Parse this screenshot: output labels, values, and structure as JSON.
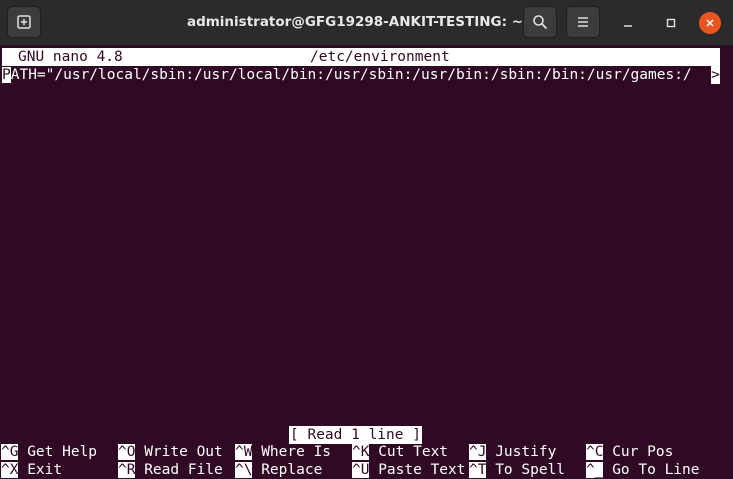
{
  "window": {
    "title": "administrator@GFG19298-ANKIT-TESTING: ~"
  },
  "nano": {
    "version": "GNU nano 4.8",
    "filename": "/etc/environment",
    "line_first_char": "P",
    "line_rest": "ATH=\"/usr/local/sbin:/usr/local/bin:/usr/sbin:/usr/bin:/sbin:/bin:/usr/games:/",
    "overflow_indicator": ">",
    "status": "[ Read 1 line ]"
  },
  "shortcuts": {
    "row1": [
      {
        "key": "^G",
        "label": "Get Help"
      },
      {
        "key": "^O",
        "label": "Write Out"
      },
      {
        "key": "^W",
        "label": "Where Is"
      },
      {
        "key": "^K",
        "label": "Cut Text"
      },
      {
        "key": "^J",
        "label": "Justify"
      },
      {
        "key": "^C",
        "label": "Cur Pos"
      }
    ],
    "row2": [
      {
        "key": "^X",
        "label": "Exit"
      },
      {
        "key": "^R",
        "label": "Read File"
      },
      {
        "key": "^\\",
        "label": "Replace"
      },
      {
        "key": "^U",
        "label": "Paste Text"
      },
      {
        "key": "^T",
        "label": "To Spell"
      },
      {
        "key": "^_",
        "label": "Go To Line"
      }
    ]
  },
  "colors": {
    "terminal_bg": "#300a24",
    "titlebar_bg": "#2b2b2b",
    "close_button": "#e95420"
  },
  "icons": {
    "new_tab": "new-tab-icon",
    "search": "search-icon",
    "menu": "hamburger-menu-icon",
    "minimize": "minimize-icon",
    "maximize": "maximize-icon",
    "close": "close-icon"
  }
}
